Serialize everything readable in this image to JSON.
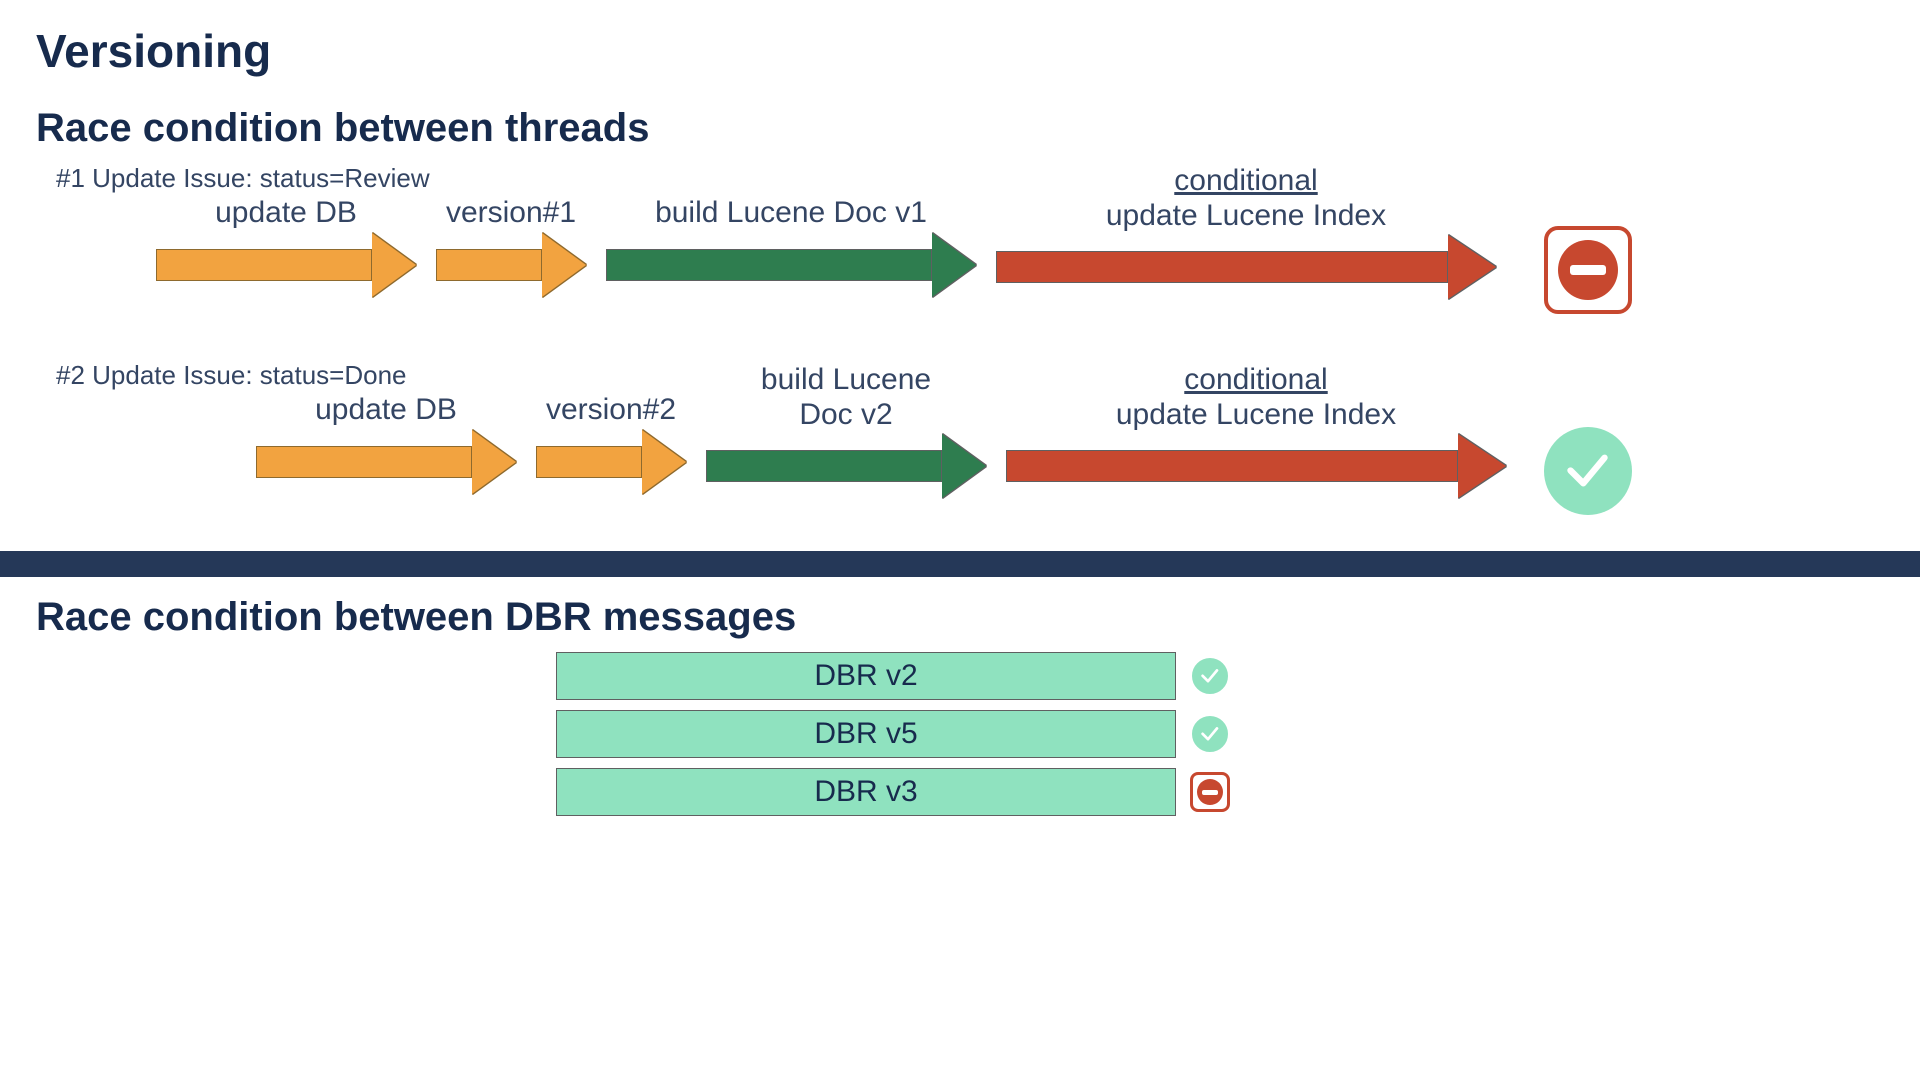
{
  "title": "Versioning",
  "section1": {
    "heading": "Race condition between threads",
    "thread1": {
      "note": "#1 Update Issue: status=Review",
      "arrows": {
        "updateDB": "update DB",
        "version": "version#1",
        "build": "build Lucene Doc v1",
        "conditional": "conditional",
        "updateIndex": "update Lucene Index"
      },
      "result": "stop"
    },
    "thread2": {
      "note": "#2 Update Issue: status=Done",
      "arrows": {
        "updateDB": "update DB",
        "version": "version#2",
        "build_line1": "build Lucene",
        "build_line2": "Doc v2",
        "conditional": "conditional",
        "updateIndex": "update Lucene Index"
      },
      "result": "ok"
    }
  },
  "section2": {
    "heading": "Race condition between DBR messages",
    "items": [
      {
        "label": "DBR v2",
        "result": "ok"
      },
      {
        "label": "DBR v5",
        "result": "ok"
      },
      {
        "label": "DBR v3",
        "result": "stop"
      }
    ]
  },
  "colors": {
    "orange": "#f2a340",
    "green": "#2e7d4f",
    "red": "#c7482f",
    "mint": "#8fe2bf",
    "navy": "#253858",
    "text": "#172b4d"
  }
}
